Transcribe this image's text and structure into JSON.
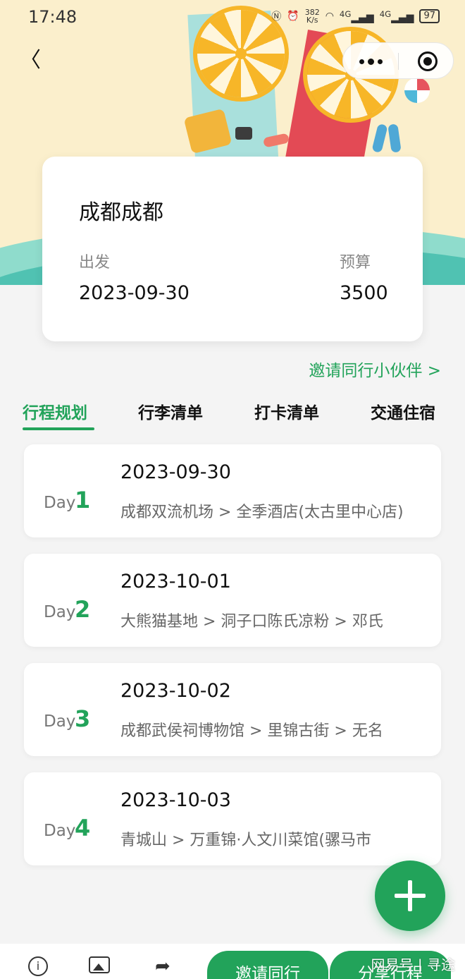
{
  "status_bar": {
    "time": "17:48",
    "network_speed_top": "382",
    "network_speed_unit": "K/s",
    "signal_1": "4G",
    "signal_2": "4G",
    "battery": "97"
  },
  "nav": {
    "back_glyph": "〈"
  },
  "trip": {
    "title": "成都成都",
    "depart_label": "出发",
    "depart_value": "2023-09-30",
    "budget_label": "预算",
    "budget_value": "3500"
  },
  "invite_link": "邀请同行小伙伴 >",
  "tabs": [
    {
      "label": "行程规划",
      "active": true
    },
    {
      "label": "行李清单",
      "active": false
    },
    {
      "label": "打卡清单",
      "active": false
    },
    {
      "label": "交通住宿",
      "active": false
    }
  ],
  "days": [
    {
      "label": "Day",
      "num": "1",
      "date": "2023-09-30",
      "route": "成都双流机场 > 全季酒店(太古里中心店)"
    },
    {
      "label": "Day",
      "num": "2",
      "date": "2023-10-01",
      "route": "大熊猫基地 > 洞子口陈氏凉粉 > 邓氏"
    },
    {
      "label": "Day",
      "num": "3",
      "date": "2023-10-02",
      "route": "成都武侯祠博物馆 > 里锦古街 > 无名"
    },
    {
      "label": "Day",
      "num": "4",
      "date": "2023-10-03",
      "route": "青城山 > 万重锦·人文川菜馆(骡马市"
    }
  ],
  "bottom_bar": {
    "info_glyph": "i",
    "share_glyph": "➦",
    "invite_button": "邀请同行",
    "share_button": "分享行程",
    "watermark": "网易号 | 寻途"
  },
  "colors": {
    "accent": "#22a35a",
    "banner_bg": "#fbefcc",
    "sea": "#50c2b2"
  }
}
